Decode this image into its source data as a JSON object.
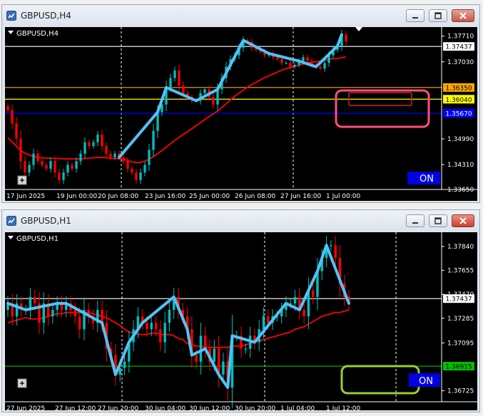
{
  "windows": [
    {
      "id": "h4",
      "title": "GBPUSD,H4",
      "symbol_label": "GBPUSD,H4",
      "on_label": "ON",
      "time_labels": [
        "17 Jun 2025",
        "19 Jun 00:00",
        "20 Jun 08:00",
        "23 Jun 16:00",
        "25 Jun 00:00",
        "26 Jun 08:00",
        "27 Jun 16:00",
        "1 Jul 00:00"
      ],
      "price_labels": [
        "1.37710",
        "1.37030",
        "1.34990",
        "1.34310",
        "1.33650"
      ],
      "tags": [
        {
          "text": "1.37437",
          "bg": "#ffffff",
          "fg": "#000000"
        },
        {
          "text": "1.36350",
          "bg": "#ffa500",
          "fg": "#000000"
        },
        {
          "text": "1.36040",
          "bg": "#ffff00",
          "fg": "#000000"
        },
        {
          "text": "1.35670",
          "bg": "#0000ff",
          "fg": "#ffffff"
        }
      ],
      "colors": {
        "up": "#00c0c0",
        "down": "#ff0000",
        "ma": "#ff0000",
        "trend": "#4fc3f7",
        "marker_box": "#ff4f7f",
        "inner_box": "#d02030"
      }
    },
    {
      "id": "h1",
      "title": "GBPUSD,H1",
      "symbol_label": "GBPUSD,H1",
      "on_label": "ON",
      "time_labels": [
        "27 Jun 2025",
        "27 Jun 12:00",
        "27 Jun 20:00",
        "30 Jun 04:00",
        "30 Jun 12:00",
        "30 Jun 20:00",
        "1 Jul 04:00",
        "1 Jul 12:00"
      ],
      "price_labels": [
        "1.37840",
        "1.37655",
        "1.37470",
        "1.37285",
        "1.37095",
        "1.36725"
      ],
      "tags": [
        {
          "text": "1.37437",
          "bg": "#ffffff",
          "fg": "#000000"
        },
        {
          "text": "1.36915",
          "bg": "#00c000",
          "fg": "#000000"
        }
      ],
      "colors": {
        "up": "#00c0c0",
        "down": "#ff0000",
        "ma": "#ff0000",
        "trend": "#4fc3f7",
        "marker_box": "#9acd32",
        "level": "#00c000"
      }
    }
  ],
  "chart_data": [
    {
      "type": "candlestick",
      "title": "GBPUSD,H4",
      "x_ticks": [
        "17 Jun 2025",
        "19 Jun 00:00",
        "20 Jun 08:00",
        "23 Jun 16:00",
        "25 Jun 00:00",
        "26 Jun 08:00",
        "27 Jun 16:00",
        "1 Jul 00:00"
      ],
      "y_ticks": [
        1.3771,
        1.3703,
        1.3499,
        1.3431,
        1.3365
      ],
      "ylim": [
        1.3365,
        1.3795
      ],
      "horizontal_levels": [
        {
          "value": 1.37437,
          "color": "#ffffff"
        },
        {
          "value": 1.3635,
          "color": "#ffa500"
        },
        {
          "value": 1.3604,
          "color": "#ffff00"
        },
        {
          "value": 1.3567,
          "color": "#0000ff"
        }
      ],
      "close": [
        1.3575,
        1.354,
        1.35,
        1.344,
        1.341,
        1.343,
        1.346,
        1.344,
        1.343,
        1.342,
        1.344,
        1.341,
        1.339,
        1.341,
        1.343,
        1.342,
        1.344,
        1.346,
        1.349,
        1.348,
        1.349,
        1.351,
        1.348,
        1.346,
        1.345,
        1.346,
        1.345,
        1.344,
        1.342,
        1.341,
        1.339,
        1.341,
        1.343,
        1.347,
        1.352,
        1.357,
        1.359,
        1.3635,
        1.366,
        1.368,
        1.364,
        1.362,
        1.361,
        1.36,
        1.36,
        1.362,
        1.363,
        1.361,
        1.359,
        1.363,
        1.366,
        1.369,
        1.371,
        1.372,
        1.374,
        1.376,
        1.3755,
        1.374,
        1.3735,
        1.373,
        1.372,
        1.3725,
        1.3715,
        1.371,
        1.37,
        1.37,
        1.369,
        1.3695,
        1.3705,
        1.3715,
        1.3705,
        1.3695,
        1.369,
        1.3685,
        1.37,
        1.372,
        1.3735,
        1.3745,
        1.3775,
        1.3757
      ],
      "ma": [
        1.3502,
        1.3491,
        1.348,
        1.3468,
        1.3461,
        1.3456,
        1.3453,
        1.345,
        1.3449,
        1.3448,
        1.3448,
        1.3447,
        1.3447,
        1.3446,
        1.3446,
        1.3446,
        1.3446,
        1.3446,
        1.3447,
        1.3448,
        1.3449,
        1.345,
        1.345,
        1.3449,
        1.3448,
        1.3447,
        1.3446,
        1.3445,
        1.3442,
        1.3438,
        1.3436,
        1.3437,
        1.344,
        1.3445,
        1.3452,
        1.346,
        1.3468,
        1.3477,
        1.3486,
        1.3495,
        1.3503,
        1.3511,
        1.3518,
        1.3526,
        1.3534,
        1.3542,
        1.355,
        1.3558,
        1.3565,
        1.3573,
        1.3582,
        1.3592,
        1.3602,
        1.3612,
        1.362,
        1.3628,
        1.3636,
        1.3643,
        1.3649,
        1.3655,
        1.3661,
        1.3666,
        1.3671,
        1.3676,
        1.3681,
        1.3685,
        1.3688,
        1.3691,
        1.3694,
        1.3697,
        1.37,
        1.3702,
        1.3703,
        1.3705,
        1.3707,
        1.3709,
        1.3711,
        1.3712,
        1.3714,
        1.3716
      ]
    },
    {
      "type": "candlestick",
      "title": "GBPUSD,H1",
      "x_ticks": [
        "27 Jun 2025",
        "27 Jun 12:00",
        "27 Jun 20:00",
        "30 Jun 04:00",
        "30 Jun 12:00",
        "30 Jun 20:00",
        "1 Jul 04:00",
        "1 Jul 12:00"
      ],
      "y_ticks": [
        1.3784,
        1.37655,
        1.3747,
        1.37285,
        1.37095,
        1.36725
      ],
      "ylim": [
        1.3664,
        1.3795
      ],
      "horizontal_levels": [
        {
          "value": 1.37437,
          "color": "#ffffff"
        },
        {
          "value": 1.36915,
          "color": "#00c000"
        }
      ],
      "close": [
        1.374,
        1.373,
        1.374,
        1.3735,
        1.3735,
        1.3745,
        1.374,
        1.3725,
        1.374,
        1.373,
        1.3735,
        1.374,
        1.3735,
        1.374,
        1.3735,
        1.373,
        1.372,
        1.3735,
        1.373,
        1.3725,
        1.3735,
        1.3725,
        1.3705,
        1.37,
        1.3685,
        1.369,
        1.3695,
        1.371,
        1.372,
        1.373,
        1.3725,
        1.372,
        1.3725,
        1.372,
        1.371,
        1.3725,
        1.3735,
        1.3745,
        1.3735,
        1.373,
        1.372,
        1.37,
        1.3695,
        1.3715,
        1.3705,
        1.3695,
        1.3705,
        1.3685,
        1.3695,
        1.3675,
        1.3715,
        1.3715,
        1.3705,
        1.3705,
        1.3715,
        1.371,
        1.372,
        1.373,
        1.3725,
        1.373,
        1.373,
        1.3735,
        1.374,
        1.374,
        1.3745,
        1.3735,
        1.373,
        1.375,
        1.3745,
        1.3765,
        1.3775,
        1.3785,
        1.3785,
        1.3775,
        1.3755,
        1.3745,
        1.374
      ],
      "ma": [
        1.3725,
        1.3726,
        1.3727,
        1.3728,
        1.3729,
        1.3728,
        1.3728,
        1.3728,
        1.3729,
        1.373,
        1.3731,
        1.3732,
        1.3732,
        1.3733,
        1.3733,
        1.3733,
        1.3733,
        1.3733,
        1.3733,
        1.3732,
        1.3731,
        1.373,
        1.3729,
        1.3727,
        1.3725,
        1.3723,
        1.372,
        1.3718,
        1.3717,
        1.3716,
        1.3716,
        1.3716,
        1.3717,
        1.3717,
        1.3716,
        1.3716,
        1.3716,
        1.3715,
        1.3713,
        1.3712,
        1.3709,
        1.3708,
        1.3707,
        1.3707,
        1.3706,
        1.3706,
        1.3706,
        1.3706,
        1.3706,
        1.3706,
        1.3707,
        1.3707,
        1.3707,
        1.3708,
        1.3709,
        1.371,
        1.3711,
        1.3712,
        1.3713,
        1.3714,
        1.3715,
        1.3716,
        1.3717,
        1.3718,
        1.372,
        1.3721,
        1.3722,
        1.3724,
        1.3726,
        1.3728,
        1.373,
        1.3731,
        1.3732,
        1.3733,
        1.3733,
        1.3734,
        1.3735
      ]
    }
  ]
}
